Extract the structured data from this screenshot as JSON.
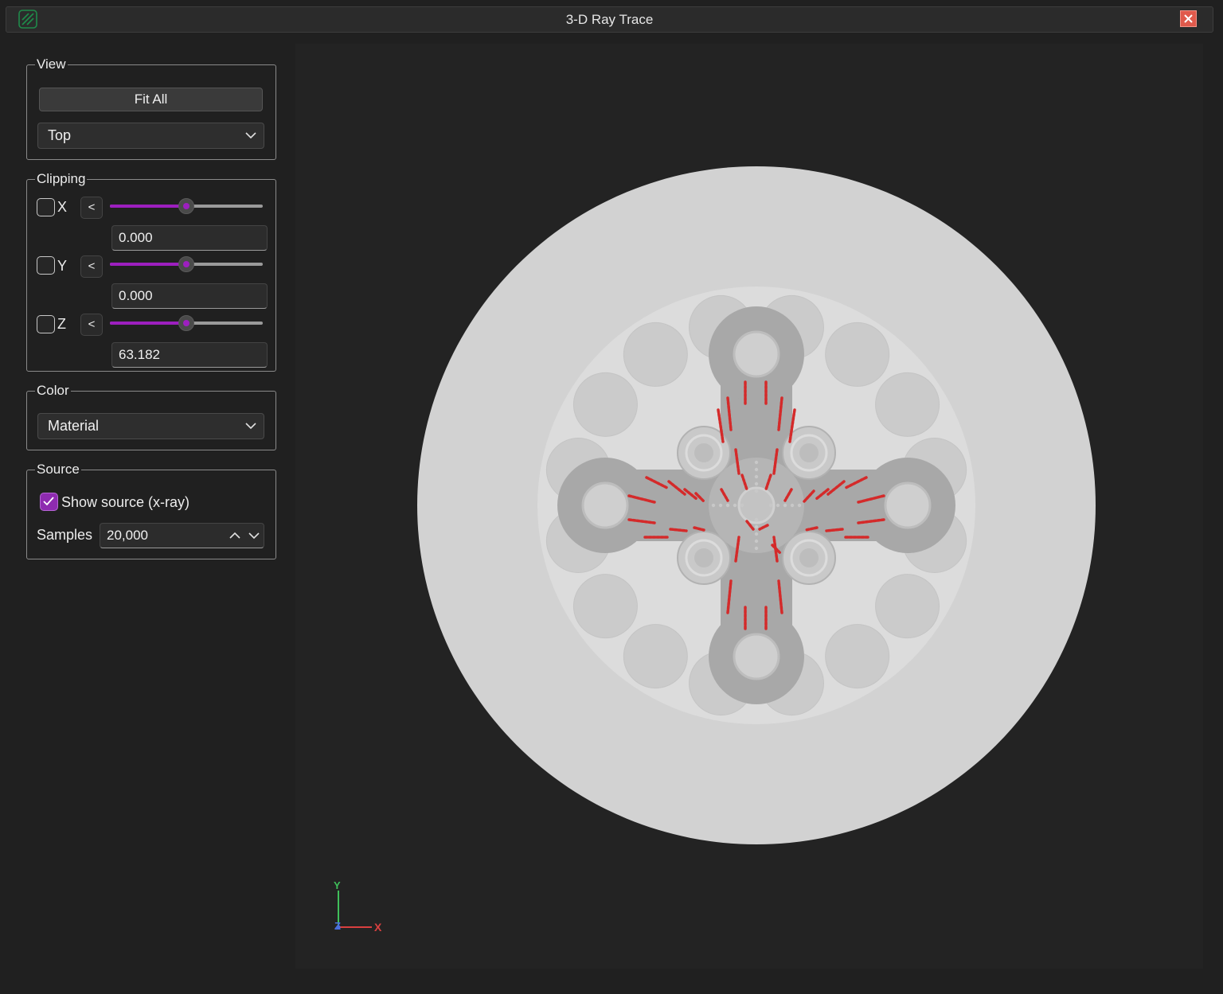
{
  "window": {
    "title": "3-D Ray Trace"
  },
  "view": {
    "legend": "View",
    "fit_all_label": "Fit All",
    "orientation": "Top"
  },
  "clipping": {
    "legend": "Clipping",
    "axes": [
      {
        "label": "X",
        "enabled": false,
        "direction": "<",
        "value": "0.000",
        "slider_level": 0.5
      },
      {
        "label": "Y",
        "enabled": false,
        "direction": "<",
        "value": "0.000",
        "slider_level": 0.5
      },
      {
        "label": "Z",
        "enabled": false,
        "direction": "<",
        "value": "63.182",
        "slider_level": 0.5
      }
    ]
  },
  "color": {
    "legend": "Color",
    "mode": "Material"
  },
  "source": {
    "legend": "Source",
    "show_source_label": "Show source (x-ray)",
    "show_source": true,
    "samples_label": "Samples",
    "samples_value": "20,000"
  },
  "axes_gizmo": {
    "y": "Y",
    "z": "Z",
    "x": "X"
  },
  "colors": {
    "accent": "#9d1fbf",
    "ray": "#d42a2a",
    "outer_disc": "#d2d2d2",
    "inner_disc": "#dcdcdc",
    "rod_fill": "#cbcbcb",
    "cross_fill": "#a8a8a8",
    "close": "#e05a4c",
    "axis_x": "#d94040",
    "axis_y": "#3fbf5a",
    "axis_z": "#4a6fe0"
  }
}
